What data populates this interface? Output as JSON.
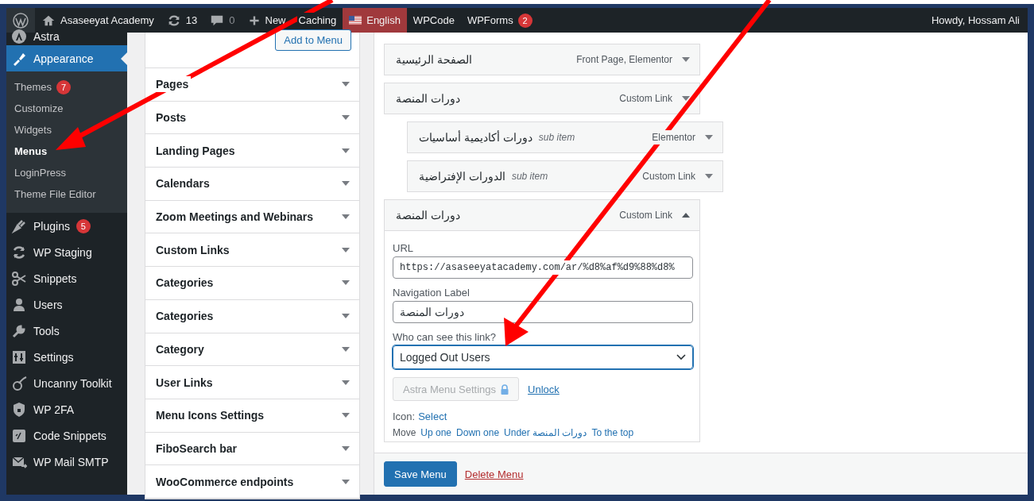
{
  "admin_bar": {
    "site_name": "Asaseeyat Academy",
    "updates": "13",
    "comments": "0",
    "new_label": "New",
    "items": [
      {
        "label": "Caching",
        "kind": "plain"
      },
      {
        "label": "English",
        "kind": "language",
        "selected": true
      },
      {
        "label": "WPCode",
        "kind": "plain"
      },
      {
        "label": "WPForms",
        "kind": "plain",
        "badge": "2"
      }
    ],
    "greeting": "Howdy, Hossam Ali"
  },
  "sidebar": {
    "items": [
      {
        "label": "Astra",
        "selected": false
      },
      {
        "label": "Appearance",
        "selected": true,
        "children": [
          {
            "label": "Themes",
            "badge": "7",
            "selected": false
          },
          {
            "label": "Customize",
            "selected": false
          },
          {
            "label": "Widgets",
            "selected": false
          },
          {
            "label": "Menus",
            "selected": true
          },
          {
            "label": "LoginPress",
            "selected": false
          },
          {
            "label": "Theme File Editor",
            "selected": false
          }
        ]
      },
      {
        "label": "Plugins",
        "badge": "5",
        "selected": false
      },
      {
        "label": "WP Staging",
        "selected": false
      },
      {
        "label": "Snippets",
        "selected": false
      },
      {
        "label": "Users",
        "selected": false
      },
      {
        "label": "Tools",
        "selected": false
      },
      {
        "label": "Settings",
        "selected": false
      },
      {
        "label": "Uncanny Toolkit",
        "selected": false
      },
      {
        "label": "WP 2FA",
        "selected": false
      },
      {
        "label": "Code Snippets",
        "selected": false
      },
      {
        "label": "WP Mail SMTP",
        "selected": false
      }
    ]
  },
  "add_items": {
    "add_button": "Add to Menu",
    "sections": [
      {
        "label": "Pages",
        "expanded": false
      },
      {
        "label": "Posts",
        "expanded": false
      },
      {
        "label": "Landing Pages",
        "expanded": false
      },
      {
        "label": "Calendars",
        "expanded": false
      },
      {
        "label": "Zoom Meetings and Webinars",
        "expanded": false
      },
      {
        "label": "Custom Links",
        "expanded": false
      },
      {
        "label": "Categories",
        "expanded": false
      },
      {
        "label": "Categories",
        "expanded": false
      },
      {
        "label": "Category",
        "expanded": false
      },
      {
        "label": "User Links",
        "expanded": false
      },
      {
        "label": "Menu Icons Settings",
        "expanded": false
      },
      {
        "label": "FiboSearch bar",
        "expanded": false
      },
      {
        "label": "WooCommerce endpoints",
        "expanded": false
      }
    ]
  },
  "menu_structure": {
    "items": [
      {
        "title": "الصفحة الرئيسية",
        "type": "Front Page, Elementor",
        "expanded": false
      },
      {
        "title": "دورات المنصة",
        "type": "Custom Link",
        "expanded": false,
        "children": [
          {
            "title": "دورات أكاديمية أساسيات",
            "note": "sub item",
            "type": "Elementor",
            "expanded": false
          },
          {
            "title": "الدورات الإفتراضية",
            "note": "sub item",
            "type": "Custom Link",
            "expanded": false
          }
        ]
      },
      {
        "title": "دورات المنصة",
        "type": "Custom Link",
        "expanded": true,
        "settings": {
          "url_label": "URL",
          "url_value": "https://asaseeyatacademy.com/ar/%d8%af%d9%88%d8%",
          "nav_label": "Navigation Label",
          "nav_value": "دورات المنصة",
          "visibility_label": "Who can see this link?",
          "visibility_value": "Logged Out Users",
          "astra_button": {
            "label": "Astra Menu Settings",
            "disabled": true
          },
          "unlock_link": "Unlock",
          "icon_label": "Icon:",
          "icon_link": "Select",
          "move_label": "Move",
          "move_links": [
            "Up one",
            "Down one",
            "Under دورات المنصة",
            "To the top"
          ]
        }
      }
    ]
  },
  "footer": {
    "save_button": "Save Menu",
    "delete_link": "Delete Menu"
  }
}
